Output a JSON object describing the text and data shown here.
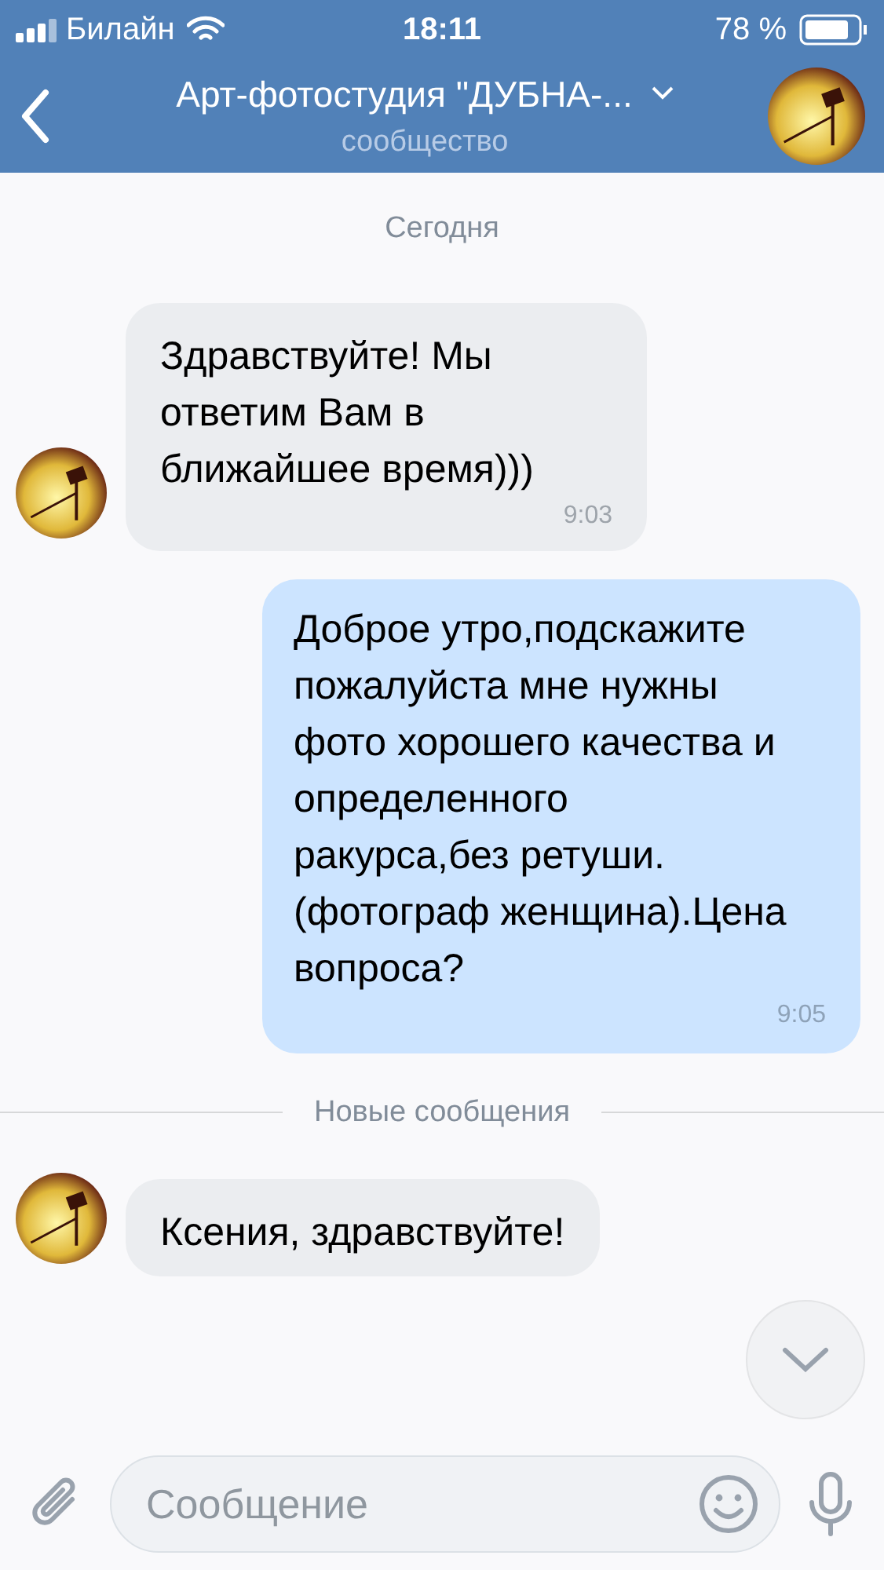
{
  "status_bar": {
    "carrier": "Билайн",
    "time": "18:11",
    "battery": "78 %"
  },
  "header": {
    "title": "Арт-фотостудия \"ДУБНА-...",
    "subtitle": "сообщество"
  },
  "messages": [
    {
      "kind": "date",
      "text": "Сегодня"
    },
    {
      "kind": "incoming",
      "text": "Здравствуйте! Мы ответим Вам в ближайшее время)))",
      "time": "9:03"
    },
    {
      "kind": "outgoing",
      "text": "Доброе утро,подскажите пожалуйста мне нужны фото хорошего качества и определенного ракурса,без ретуши.(фотограф женщина).Цена вопроса?",
      "time": "9:05"
    },
    {
      "kind": "divider",
      "text": "Новые сообщения"
    },
    {
      "kind": "incoming",
      "text": "Ксения, здравствуйте!"
    }
  ],
  "composer": {
    "placeholder": "Сообщение"
  }
}
